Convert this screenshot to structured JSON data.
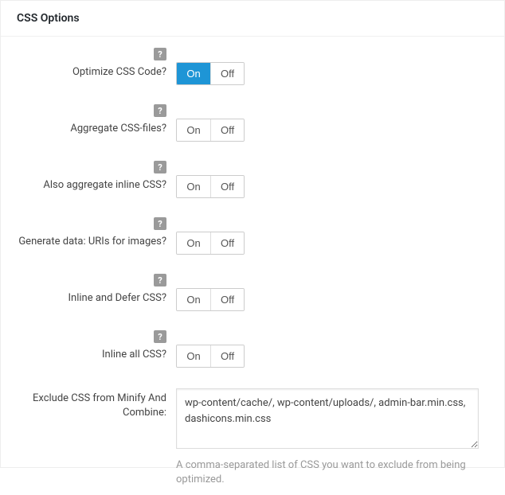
{
  "heading": "CSS Options",
  "toggle": {
    "on": "On",
    "off": "Off"
  },
  "rows": {
    "optimize": {
      "label": "Optimize CSS Code?",
      "help": "?",
      "state": "on"
    },
    "aggregate": {
      "label": "Aggregate CSS-files?",
      "help": "?",
      "state": "off"
    },
    "inlineagg": {
      "label": "Also aggregate inline CSS?",
      "help": "?",
      "state": "off"
    },
    "datauri": {
      "label": "Generate data: URIs for images?",
      "help": "?",
      "state": "off"
    },
    "defer": {
      "label": "Inline and Defer CSS?",
      "help": "?",
      "state": "off"
    },
    "inlineall": {
      "label": "Inline all CSS?",
      "help": "?",
      "state": "off"
    },
    "exclude": {
      "label": "Exclude CSS from Minify And Combine:",
      "value": "wp-content/cache/, wp-content/uploads/, admin-bar.min.css, dashicons.min.css",
      "description": "A comma-separated list of CSS you want to exclude from being optimized."
    }
  }
}
